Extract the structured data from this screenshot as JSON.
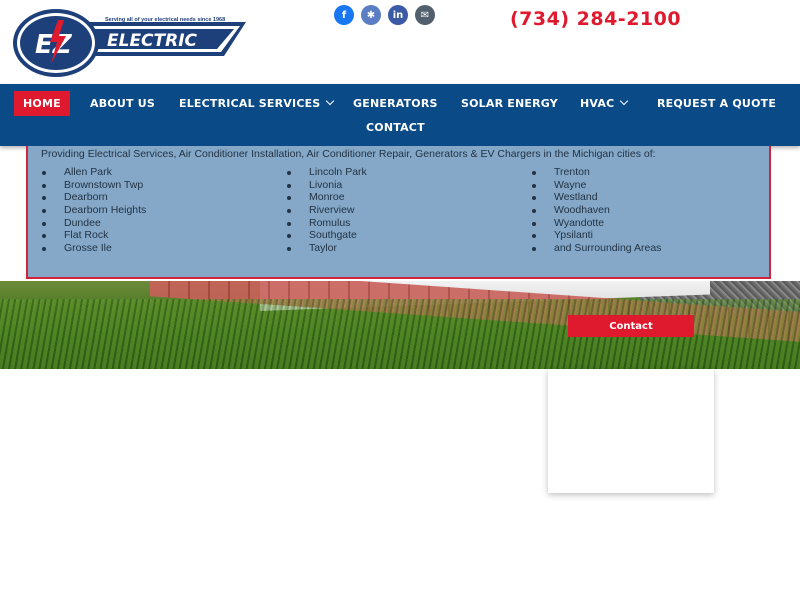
{
  "header": {
    "logo": {
      "mark": "EZ",
      "word": "ELECTRIC",
      "tagline": "Serving all of your electrical needs since 1968"
    },
    "socials": [
      {
        "name": "facebook-icon",
        "glyph": "f"
      },
      {
        "name": "yelp-icon",
        "glyph": "✱"
      },
      {
        "name": "linkedin-icon",
        "glyph": "in"
      },
      {
        "name": "email-icon",
        "glyph": "✉"
      }
    ],
    "phone": "(734) 284-2100"
  },
  "nav": {
    "items": [
      {
        "label": "HOME",
        "active": true
      },
      {
        "label": "ABOUT US"
      },
      {
        "label": "ELECTRICAL SERVICES",
        "dropdown": true
      },
      {
        "label": "GENERATORS"
      },
      {
        "label": "SOLAR ENERGY"
      },
      {
        "label": "HVAC",
        "dropdown": true
      },
      {
        "label": "REQUEST A QUOTE"
      },
      {
        "label": "CONTACT"
      }
    ]
  },
  "service_area": {
    "intro": "Providing Electrical Services, Air Conditioner Installation, Air Conditioner Repair, Generators & EV Chargers in the Michigan cities of:",
    "columns": [
      [
        "Allen Park",
        "Brownstown Twp",
        "Dearborn",
        "Dearborn Heights",
        "Dundee",
        "Flat Rock",
        "Grosse Ile"
      ],
      [
        "Lincoln Park",
        "Livonia",
        "Monroe",
        "Riverview",
        "Romulus",
        "Southgate",
        "Taylor"
      ],
      [
        "Trenton",
        "Wayne",
        "Westland",
        "Woodhaven",
        "Wyandotte",
        "Ypsilanti",
        "and Surrounding Areas"
      ]
    ]
  },
  "banner": {
    "contact_label": "Contact"
  },
  "colors": {
    "brand_blue": "#0a4a86",
    "accent_red": "#e01a2e",
    "service_bg": "#85a8c8"
  }
}
